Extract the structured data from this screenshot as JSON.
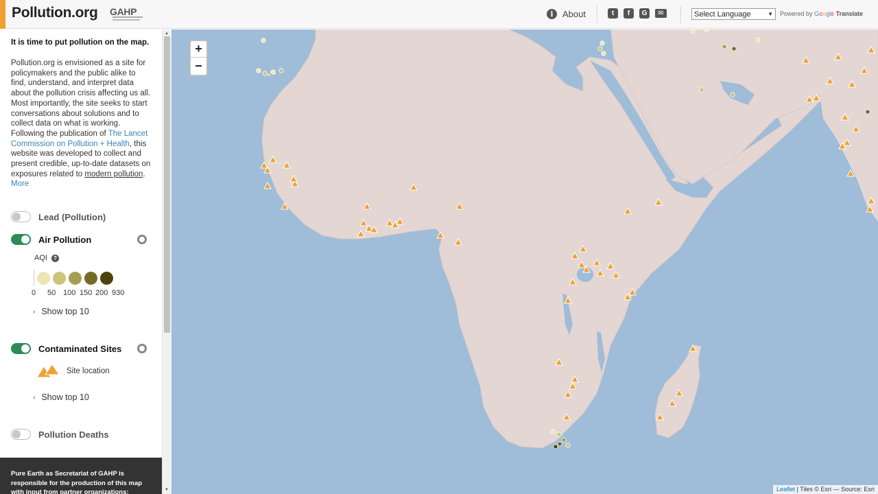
{
  "header": {
    "brand": "Pollution.org",
    "partner_logo": "GAHP",
    "about_label": "About",
    "about_icon": "info-circle-icon",
    "social_icons": [
      "twitter-icon",
      "facebook-icon",
      "google-plus-icon",
      "email-icon"
    ],
    "language_select": "Select Language",
    "powered_by": "Powered by",
    "google": "Google",
    "translate": "Translate"
  },
  "sidebar": {
    "intro_title": "It is time to put pollution on the map.",
    "intro_part1": "Pollution.org is envisioned as a site for policymakers and the public alike to find, understand, and interpret data about the pollution crisis affecting us all. Most importantly, the site seeks to start conversations about solutions and to collect data on what is working. Following the publication of ",
    "lancet_link": "The Lancet Commission on Pollution + Health",
    "intro_part2": ", this website was developed to collect and present credible, up-to-date datasets on exposures related to ",
    "modern_pollution_link": "modern pollution",
    "intro_part3": ". ",
    "more_link": "More",
    "layers": [
      {
        "label": "Lead (Pollution)",
        "enabled": false
      },
      {
        "label": "Air Pollution",
        "enabled": true
      },
      {
        "label": "Contaminated Sites",
        "enabled": true
      },
      {
        "label": "Pollution Deaths",
        "enabled": false
      }
    ],
    "aqi_label": "AQI",
    "aqi_colors": [
      "#ece7b2",
      "#cdc47a",
      "#a89e52",
      "#776a28",
      "#4c420d"
    ],
    "aqi_ticks": [
      "0",
      "50",
      "100",
      "150",
      "200",
      "930"
    ],
    "show_top_air": "Show top 10",
    "site_location_label": "Site location",
    "site_color": "#f0a030",
    "show_top_sites": "Show top 10",
    "footer_text": "Pure Earth as Secretariat of GAHP is responsible for the production of this map with input from partner organizations:"
  },
  "map": {
    "zoom_in": "+",
    "zoom_out": "−",
    "attribution_link": "Leaflet",
    "attribution_text": " | Tiles © Esri — Source: Esri",
    "water_color": "#9fbcd8",
    "land_color": "#e3d6d3"
  }
}
